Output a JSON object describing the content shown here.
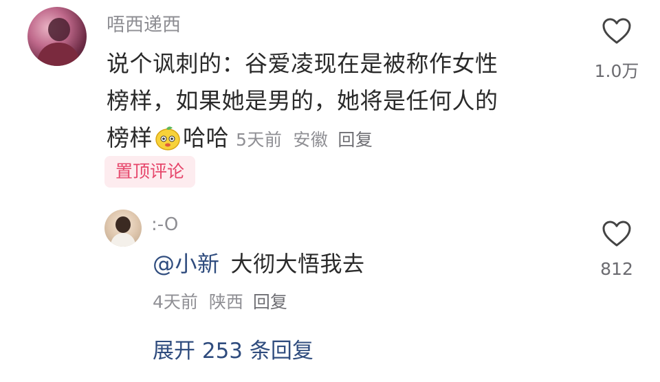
{
  "comment": {
    "username": "唔西递西",
    "text_line1": "说个讽刺的：谷爱凌现在是被称作女性",
    "text_line2": "榜样，如果她是男的，她将是任何人的",
    "text_line3_a": "榜样",
    "emoji_icon": "lemon-face-emoji-icon",
    "text_line3_b": "哈哈",
    "time": "5天前",
    "location": "安徽",
    "reply_label": "回复",
    "pin_badge": "置顶评论",
    "like_count": "1.0万"
  },
  "reply": {
    "username": ":-O",
    "mention": "@小新",
    "text": "大彻大悟我去",
    "time": "4天前",
    "location": "陕西",
    "reply_label": "回复",
    "like_count": "812"
  },
  "expand_replies": "展开 253 条回复",
  "colors": {
    "pin_text": "#e6456a",
    "pin_bg": "#fdecef",
    "link_blue": "#2f4c7e",
    "meta_gray": "#8f8f94"
  }
}
